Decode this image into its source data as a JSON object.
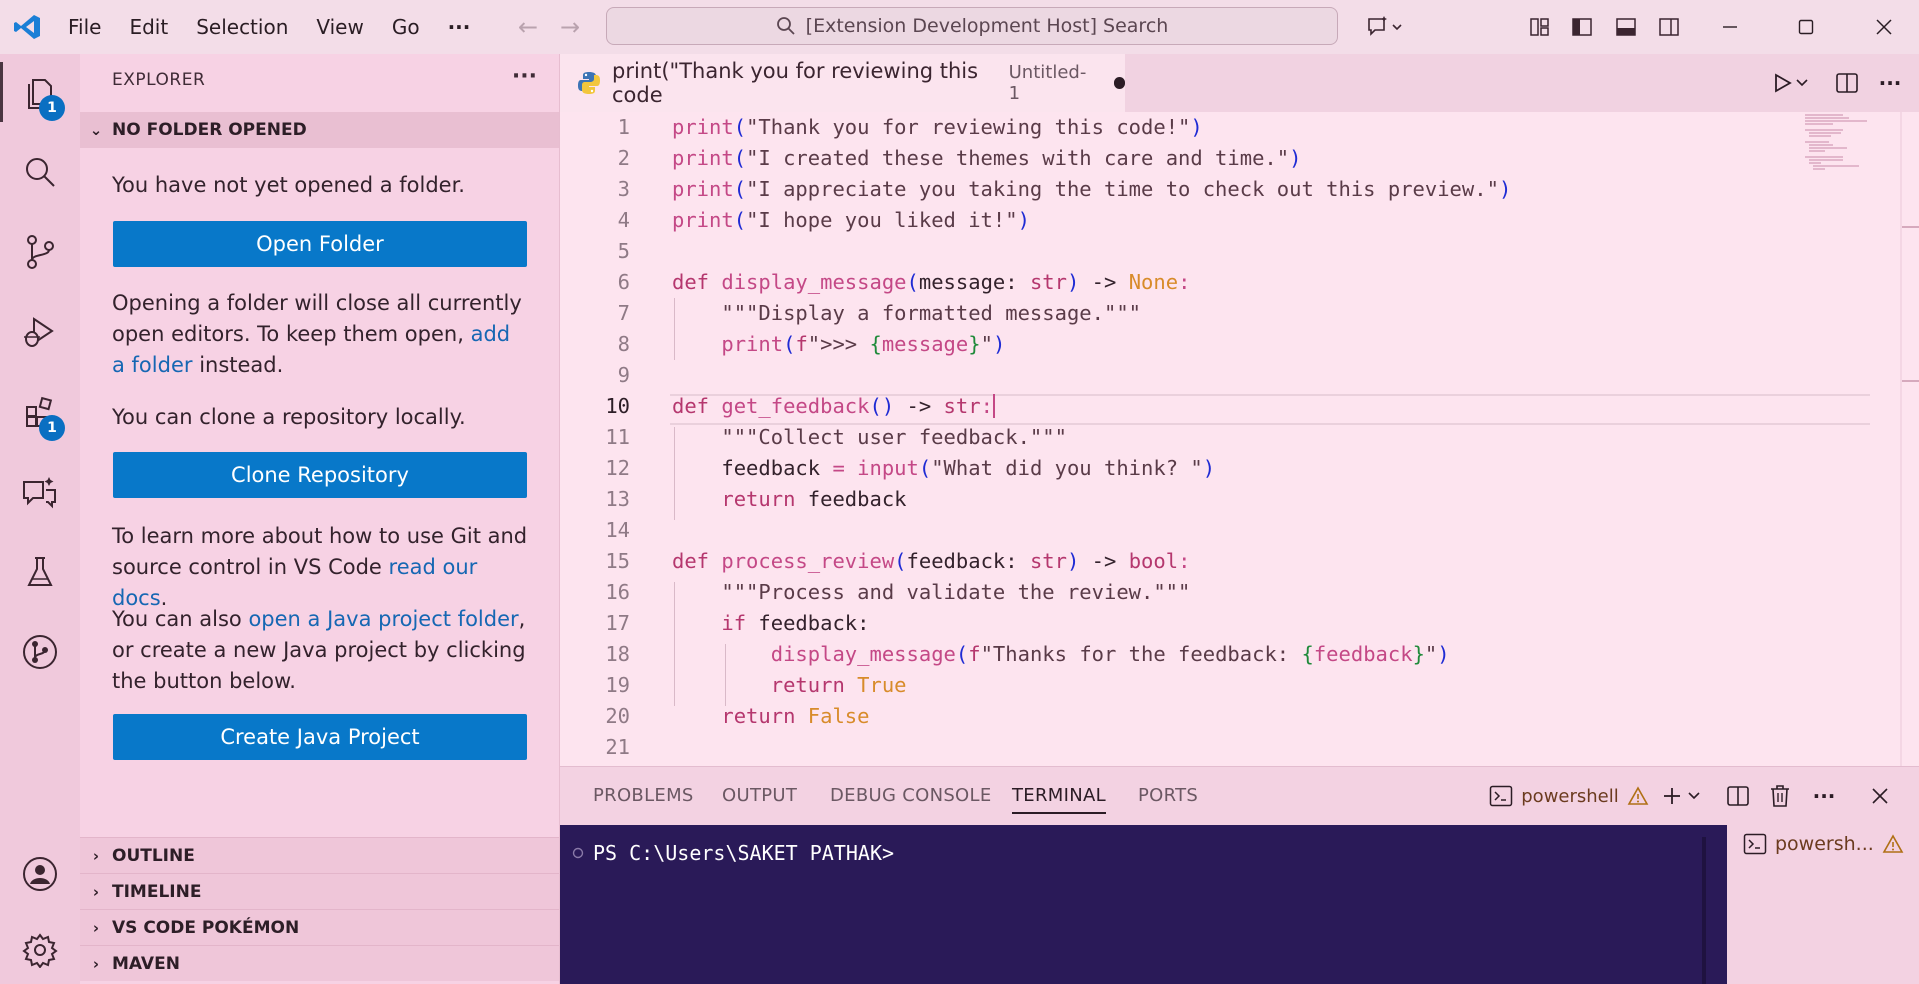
{
  "window": {
    "search_text": "[Extension Development Host] Search",
    "menu": [
      "File",
      "Edit",
      "Selection",
      "View",
      "Go"
    ],
    "menu_more": "···"
  },
  "activity_bar": {
    "explorer_badge": "1",
    "extensions_badge": "1"
  },
  "sidebar": {
    "title": "EXPLORER",
    "more": "···",
    "section": "NO FOLDER OPENED",
    "msg1": "You have not yet opened a folder.",
    "open_folder_btn": "Open Folder",
    "msg2_a": "Opening a folder will close all currently open editors. To keep them open, ",
    "msg2_link": "add a folder",
    "msg2_b": " instead.",
    "msg3": "You can clone a repository locally.",
    "clone_btn": "Clone Repository",
    "msg4_a": "To learn more about how to use Git and source control in VS Code ",
    "msg4_link": "read our docs",
    "msg4_b": ".",
    "msg5_a": "You can also ",
    "msg5_link": "open a Java project folder",
    "msg5_b": ", or create a new Java project by clicking the button below.",
    "java_btn": "Create Java Project",
    "bottom_sections": [
      "OUTLINE",
      "TIMELINE",
      "VS CODE POKÉMON",
      "MAVEN"
    ]
  },
  "editor": {
    "tab_title": "print(\"Thank you for reviewing this code",
    "tab_desc": "Untitled-1",
    "current_line": 10,
    "line_numbers": [
      "1",
      "2",
      "3",
      "4",
      "5",
      "6",
      "7",
      "8",
      "9",
      "10",
      "11",
      "12",
      "13",
      "14",
      "15",
      "16",
      "17",
      "18",
      "19",
      "20",
      "21"
    ]
  },
  "panel": {
    "tabs": [
      "PROBLEMS",
      "OUTPUT",
      "DEBUG CONSOLE",
      "TERMINAL",
      "PORTS"
    ],
    "active_tab": "TERMINAL",
    "terminal_name": "powershell",
    "terminal_list_item": "powersh...",
    "prompt": "PS C:\\Users\\SAKET PATHAK>"
  },
  "colors": {
    "accent": "#0878c9",
    "background": "#f7d2e4",
    "editor_bg": "#fde4ef",
    "terminal_bg": "#2a1a58"
  }
}
